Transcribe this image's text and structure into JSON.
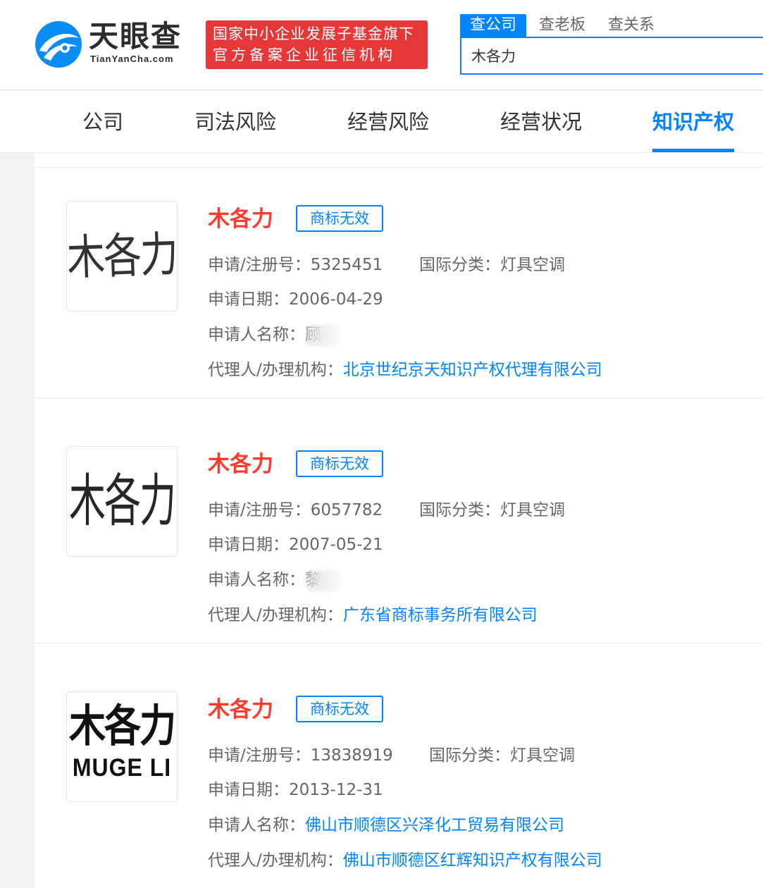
{
  "header": {
    "logo_cn": "天眼查",
    "logo_en": "TianYanCha.com",
    "fund_badge_line1": "国家中小企业发展子基金旗下",
    "fund_badge_line2": "官方备案企业征信机构",
    "search_tabs": [
      "查公司",
      "查老板",
      "查关系"
    ],
    "search_value": "木各力"
  },
  "nav": {
    "items": [
      "公司",
      "司法风险",
      "经营风险",
      "经营状况",
      "知识产权"
    ],
    "active": "知识产权"
  },
  "labels": {
    "reg_no": "申请/注册号：",
    "intl_class": "国际分类：",
    "apply_date": "申请日期：",
    "applicant": "申请人名称：",
    "agent": "代理人/办理机构："
  },
  "trademarks": [
    {
      "image_text": "木各力",
      "name": "木各力",
      "status": "商标无效",
      "reg_no": "5325451",
      "intl_class": "灯具空调",
      "apply_date": "2006-04-29",
      "applicant": "顾",
      "applicant_masked": true,
      "agent": "北京世纪京天知识产权代理有限公司"
    },
    {
      "image_text": "木各力",
      "name": "木各力",
      "status": "商标无效",
      "reg_no": "6057782",
      "intl_class": "灯具空调",
      "apply_date": "2007-05-21",
      "applicant": "黎",
      "applicant_masked": true,
      "agent": "广东省商标事务所有限公司"
    },
    {
      "image_text": "木各力",
      "image_text_en": "MUGE LI",
      "name": "木各力",
      "status": "商标无效",
      "reg_no": "13838919",
      "intl_class": "灯具空调",
      "apply_date": "2013-12-31",
      "applicant": "佛山市顺德区兴泽化工贸易有限公司",
      "applicant_masked": false,
      "agent": "佛山市顺德区红辉知识产权有限公司"
    }
  ],
  "colors": {
    "brand_blue": "#0084ff",
    "badge_red": "#e63838",
    "name_red": "#ff3a2e"
  }
}
